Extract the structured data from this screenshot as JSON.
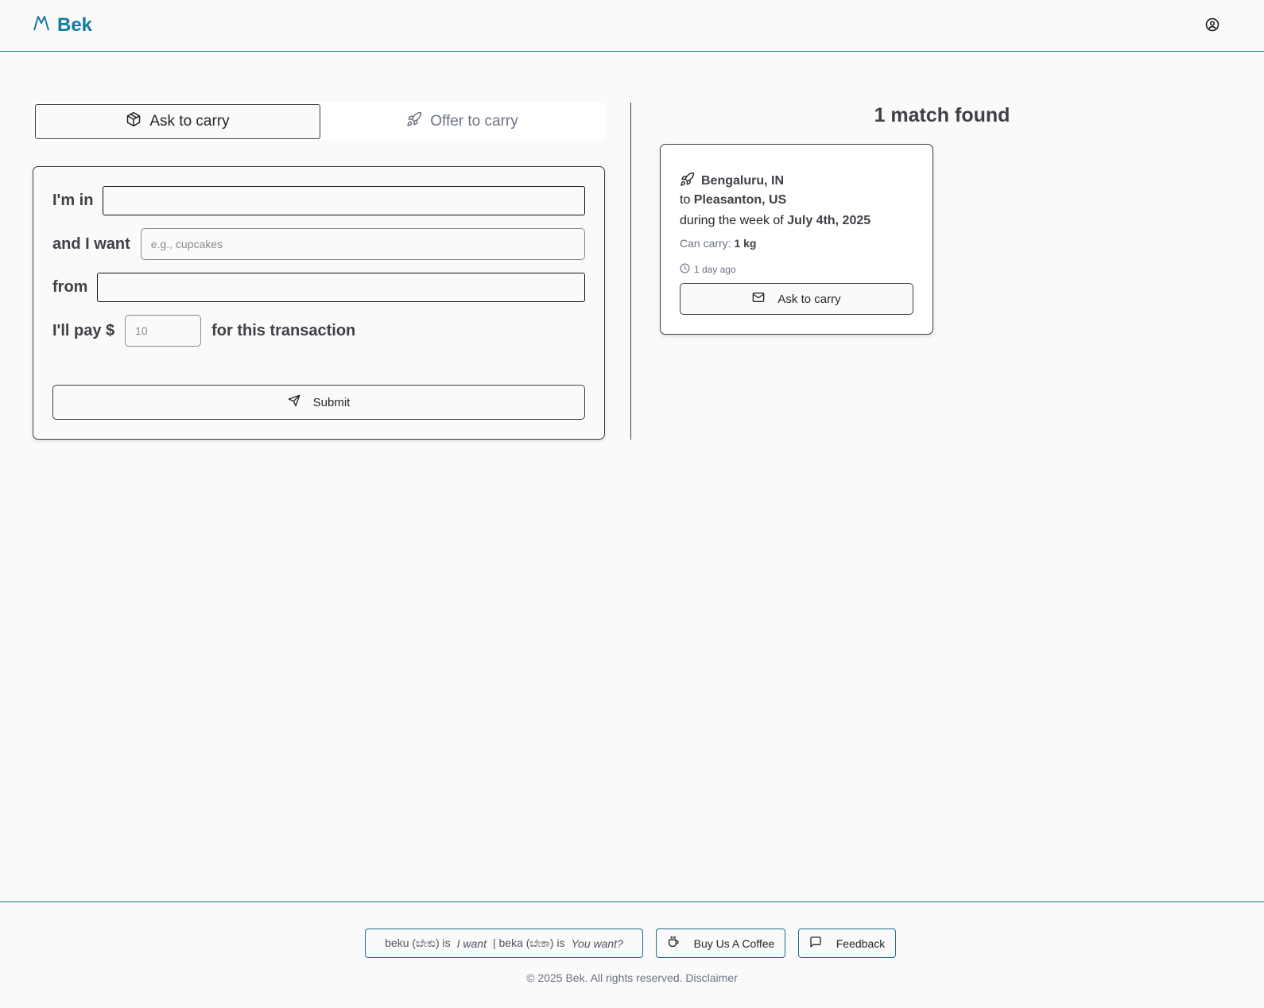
{
  "header": {
    "brand": "Bek",
    "logo_icon": "mountain-icon",
    "user_icon": "user-circle-icon"
  },
  "tabs": [
    {
      "label": "Ask to carry",
      "icon": "package-icon",
      "active": true
    },
    {
      "label": "Offer to carry",
      "icon": "rocket-icon",
      "active": false
    }
  ],
  "form": {
    "location_label": "I'm in",
    "location_value": "",
    "want_label": "and I want",
    "want_placeholder": "e.g., cupcakes",
    "from_label": "from",
    "from_value": "",
    "pay_label": "I'll pay $",
    "pay_placeholder": "10",
    "pay_suffix": "for this transaction",
    "submit_label": "Submit"
  },
  "results": {
    "title": "1 match found",
    "matches": [
      {
        "from": "Bengaluru, IN",
        "to_prefix": "to",
        "to": "Pleasanton, US",
        "week_prefix": "during the week of",
        "week": "July 4th, 2025",
        "capacity_label": "Can carry:",
        "capacity": "1 kg",
        "posted": "1 day ago",
        "action_label": "Ask to carry"
      }
    ]
  },
  "footer": {
    "motto_part1": "beku (ಬೇಕು) is",
    "motto_italic1": "I want",
    "motto_part2": "| beka (ಬೇಕಾ) is",
    "motto_italic2": "You want?",
    "coffee_label": "Buy Us A Coffee",
    "feedback_label": "Feedback",
    "copyright": "© 2025 Bek. All rights reserved.",
    "disclaimer": "Disclaimer"
  },
  "colors": {
    "brand": "#1479a3",
    "border_accent": "#1e6e8a",
    "background": "#fafafa"
  }
}
